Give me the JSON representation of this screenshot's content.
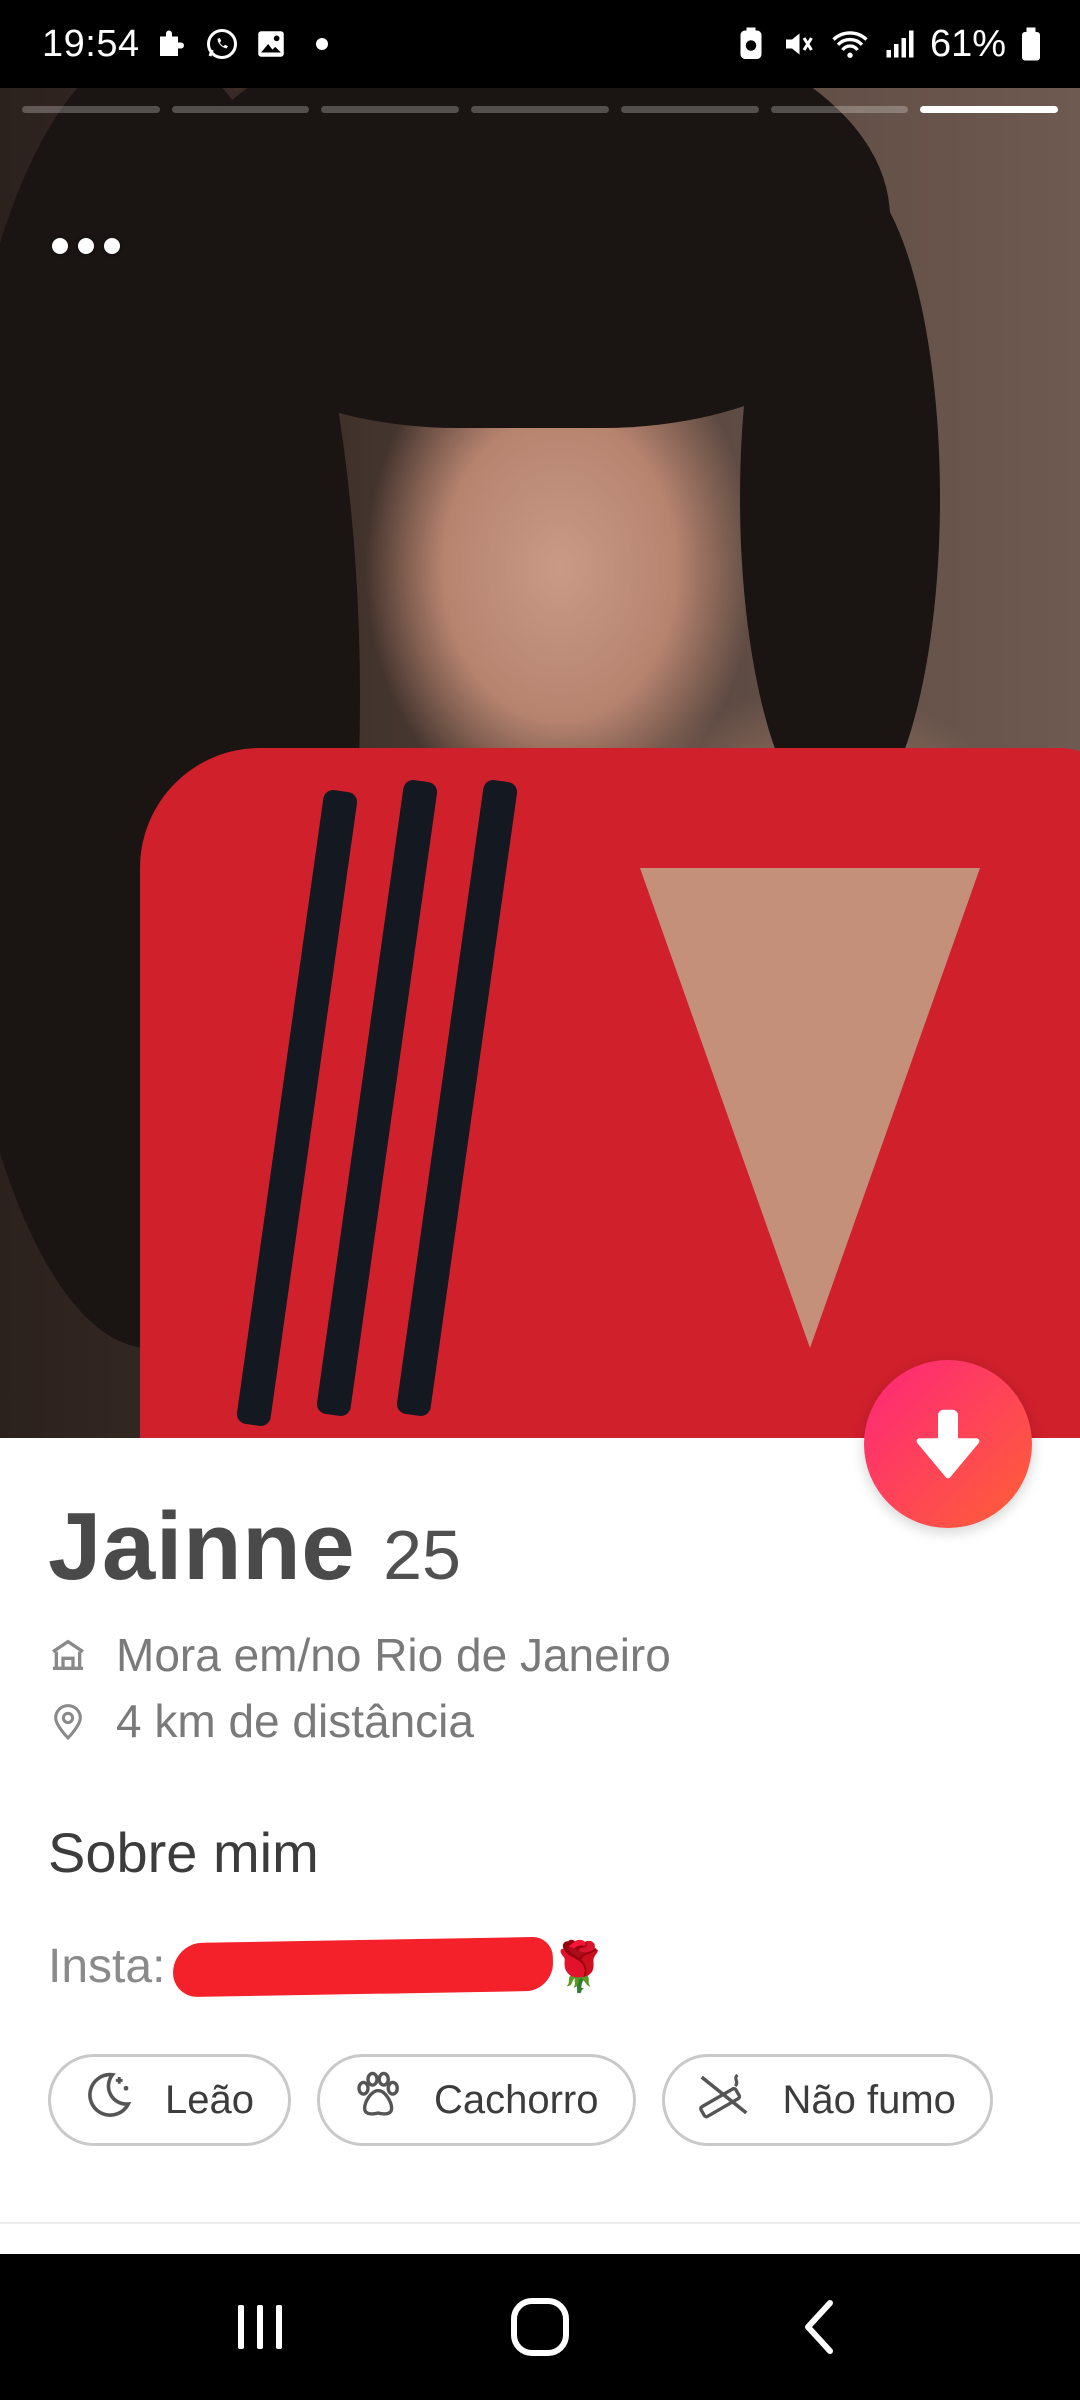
{
  "status_bar": {
    "time": "19:54",
    "battery": "61%",
    "icons": [
      "puzzle-icon",
      "whatsapp-icon",
      "gallery-icon",
      "dot-icon",
      "battery-saver-icon",
      "mute-icon",
      "wifi-icon",
      "signal-icon",
      "battery-icon"
    ]
  },
  "photo": {
    "pager_segments": 7,
    "active_segment": 7
  },
  "profile": {
    "name": "Jainne",
    "age": "25",
    "lives_in": "Mora em/no Rio de Janeiro",
    "distance": "4 km de distância",
    "about_title": "Sobre mim",
    "insta_label": "Insta:",
    "rose_emoji": "🌹",
    "chips": [
      {
        "icon": "moon-icon",
        "label": "Leão"
      },
      {
        "icon": "paw-icon",
        "label": "Cachorro"
      },
      {
        "icon": "no-smoking-icon",
        "label": "Não fumo"
      }
    ]
  },
  "colors": {
    "accent_gradient_start": "#fd267a",
    "accent_gradient_end": "#ff6036",
    "redaction": "#f4202a"
  },
  "nav": {
    "icons": [
      "recents-icon",
      "home-icon",
      "back-icon"
    ]
  }
}
